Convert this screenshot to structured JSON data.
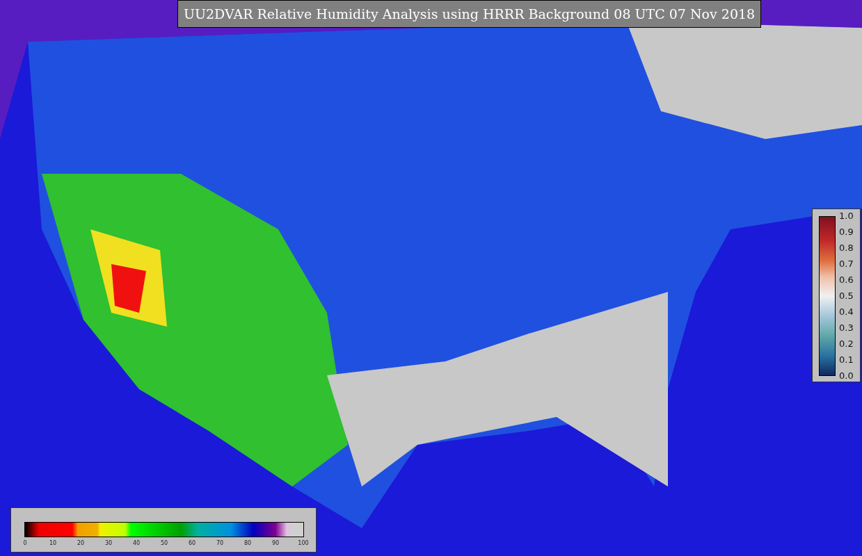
{
  "title": "UU2DVAR Relative Humidity Analysis using HRRR Background 08 UTC 07 Nov 2018",
  "humidity_colorbar": {
    "ticks": [
      "0",
      "10",
      "20",
      "30",
      "40",
      "50",
      "60",
      "70",
      "80",
      "90",
      "100"
    ]
  },
  "ratio_colorbar": {
    "ticks": [
      "1.0",
      "0.9",
      "0.8",
      "0.7",
      "0.6",
      "0.5",
      "0.4",
      "0.3",
      "0.2",
      "0.1",
      "0.0"
    ]
  }
}
